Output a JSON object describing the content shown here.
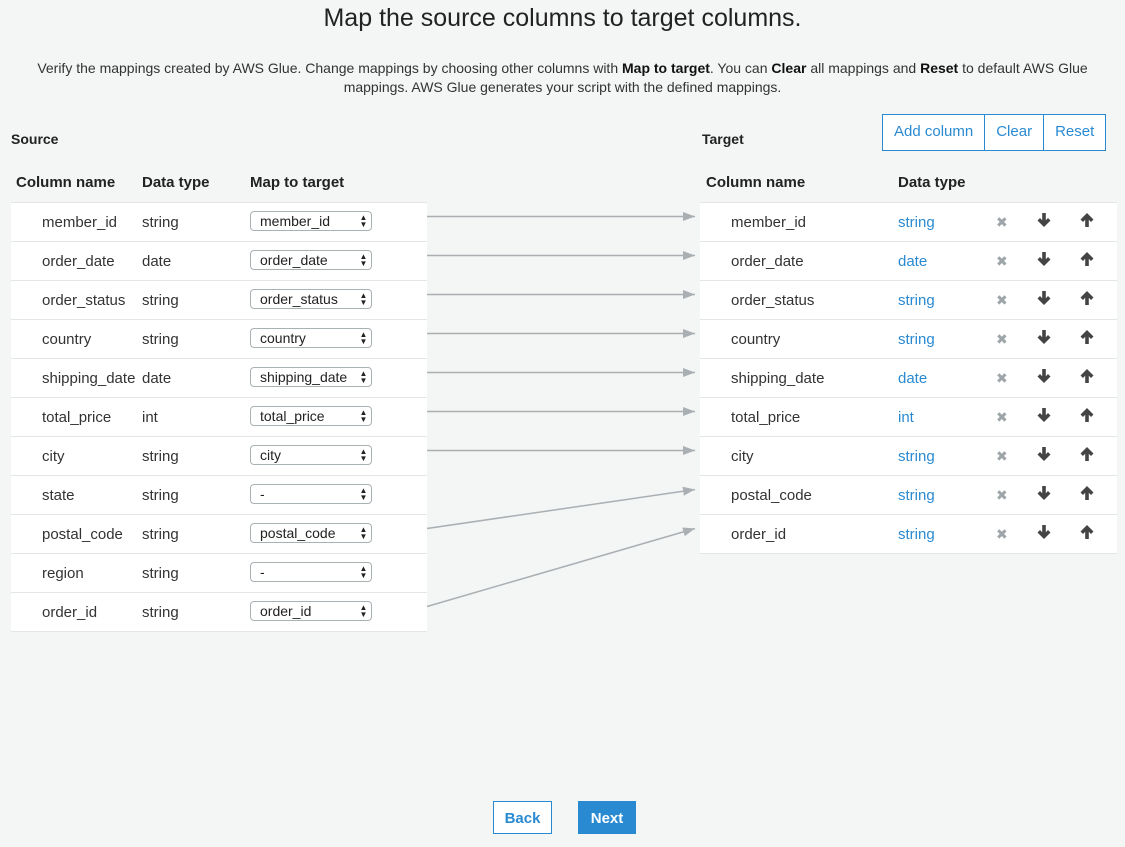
{
  "heading": "Map the source columns to target columns.",
  "description": {
    "p1": "Verify the mappings created by AWS Glue. Change mappings by choosing other columns with ",
    "b1": "Map to target",
    "p2": ". You can ",
    "b2": "Clear",
    "p3": " all mappings and ",
    "b3": "Reset",
    "p4": " to default AWS Glue mappings. AWS Glue generates your script with the defined mappings."
  },
  "source": {
    "label": "Source",
    "headers": {
      "name": "Column name",
      "type": "Data type",
      "map": "Map to target"
    },
    "rows": [
      {
        "name": "member_id",
        "type": "string",
        "map": "member_id"
      },
      {
        "name": "order_date",
        "type": "date",
        "map": "order_date"
      },
      {
        "name": "order_status",
        "type": "string",
        "map": "order_status"
      },
      {
        "name": "country",
        "type": "string",
        "map": "country"
      },
      {
        "name": "shipping_date",
        "type": "date",
        "map": "shipping_date"
      },
      {
        "name": "total_price",
        "type": "int",
        "map": "total_price"
      },
      {
        "name": "city",
        "type": "string",
        "map": "city"
      },
      {
        "name": "state",
        "type": "string",
        "map": "-"
      },
      {
        "name": "postal_code",
        "type": "string",
        "map": "postal_code"
      },
      {
        "name": "region",
        "type": "string",
        "map": "-"
      },
      {
        "name": "order_id",
        "type": "string",
        "map": "order_id"
      }
    ]
  },
  "target": {
    "label": "Target",
    "headers": {
      "name": "Column name",
      "type": "Data type"
    },
    "rows": [
      {
        "name": "member_id",
        "type": "string"
      },
      {
        "name": "order_date",
        "type": "date"
      },
      {
        "name": "order_status",
        "type": "string"
      },
      {
        "name": "country",
        "type": "string"
      },
      {
        "name": "shipping_date",
        "type": "date"
      },
      {
        "name": "total_price",
        "type": "int"
      },
      {
        "name": "city",
        "type": "string"
      },
      {
        "name": "postal_code",
        "type": "string"
      },
      {
        "name": "order_id",
        "type": "string"
      }
    ],
    "row_actions": {
      "remove_icon": "remove-icon",
      "down_icon": "arrow-down-icon",
      "up_icon": "arrow-up-icon"
    }
  },
  "mappings": [
    {
      "source_index": 0,
      "target_index": 0
    },
    {
      "source_index": 1,
      "target_index": 1
    },
    {
      "source_index": 2,
      "target_index": 2
    },
    {
      "source_index": 3,
      "target_index": 3
    },
    {
      "source_index": 4,
      "target_index": 4
    },
    {
      "source_index": 5,
      "target_index": 5
    },
    {
      "source_index": 6,
      "target_index": 6
    },
    {
      "source_index": 8,
      "target_index": 7
    },
    {
      "source_index": 10,
      "target_index": 8
    }
  ],
  "toolbar": {
    "add_column": "Add column",
    "clear": "Clear",
    "reset": "Reset"
  },
  "footer": {
    "back": "Back",
    "next": "Next"
  },
  "colors": {
    "accent": "#2a8ad1",
    "background": "#f4f5f5",
    "line": "#a9afb2"
  }
}
